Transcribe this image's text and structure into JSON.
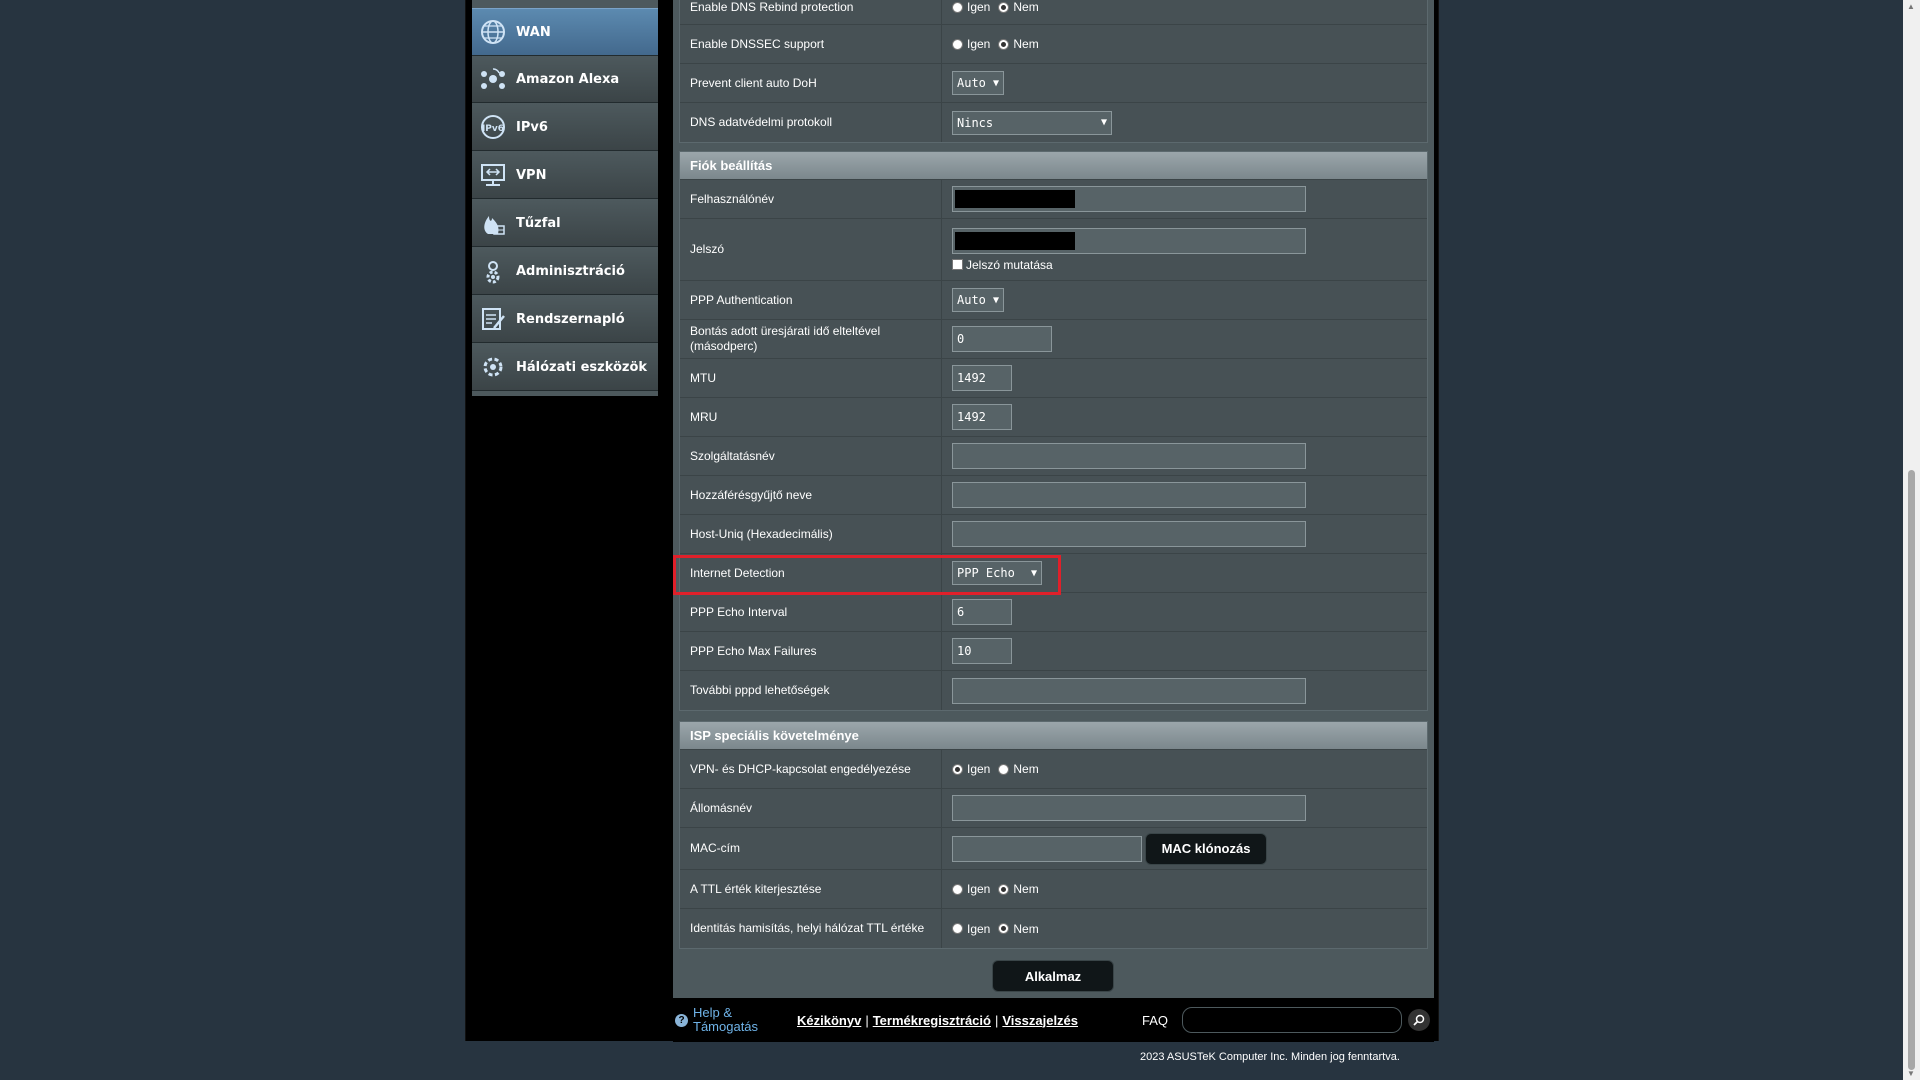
{
  "sidebar": {
    "items": [
      {
        "label": "WAN",
        "icon": "globe-icon"
      },
      {
        "label": "Amazon Alexa",
        "icon": "alexa-icon"
      },
      {
        "label": "IPv6",
        "icon": "ipv6-icon"
      },
      {
        "label": "VPN",
        "icon": "vpn-icon"
      },
      {
        "label": "Tűzfal",
        "icon": "firewall-icon"
      },
      {
        "label": "Adminisztráció",
        "icon": "admin-gear-icon"
      },
      {
        "label": "Rendszernapló",
        "icon": "system-log-icon"
      },
      {
        "label": "Hálózati eszközök",
        "icon": "network-tools-icon"
      }
    ]
  },
  "dns": {
    "rebind_label": "Enable DNS Rebind protection",
    "dnssec_label": "Enable DNSSEC support",
    "doh_label": "Prevent client auto DoH",
    "doh_value": "Auto",
    "privacy_label": "DNS adatvédelmi protokoll",
    "privacy_value": "Nincs"
  },
  "radio": {
    "yes": "Igen",
    "no": "Nem"
  },
  "account": {
    "header": "Fiók beállítás",
    "username_label": "Felhasználónév",
    "password_label": "Jelszó",
    "show_password": "Jelszó mutatása",
    "ppp_auth_label": "PPP Authentication",
    "ppp_auth_value": "Auto",
    "idle_label": "Bontás adott üresjárati idő elteltével (másodperc)",
    "idle_value": "0",
    "mtu_label": "MTU",
    "mtu_value": "1492",
    "mru_label": "MRU",
    "mru_value": "1492",
    "service_label": "Szolgáltatásnév",
    "ac_label": "Hozzáférésgyűjtő neve",
    "hostuniq_label": "Host-Uniq (Hexadecimális)",
    "detection_label": "Internet Detection",
    "detection_value": "PPP Echo",
    "echo_interval_label": "PPP Echo Interval",
    "echo_interval_value": "6",
    "echo_fail_label": "PPP Echo Max Failures",
    "echo_fail_value": "10",
    "pppd_label": "További pppd lehetőségek"
  },
  "isp": {
    "header": "ISP speciális követelménye",
    "vpn_dhcp_label": "VPN- és DHCP-kapcsolat engedélyezése",
    "hostname_label": "Állomásnév",
    "mac_label": "MAC-cím",
    "mac_clone": "MAC klónozás",
    "ttl_label": "A TTL érték kiterjesztése",
    "spoof_label": "Identitás hamisítás, helyi hálózat TTL értéke"
  },
  "apply": "Alkalmaz",
  "footer": {
    "help": "Help & Támogatás",
    "manual": "Kézikönyv",
    "reg": "Termékregisztráció",
    "feedback": "Visszajelzés",
    "faq": "FAQ",
    "copyright": "2023 ASUSTeK Computer Inc. Minden jog fenntartva."
  }
}
